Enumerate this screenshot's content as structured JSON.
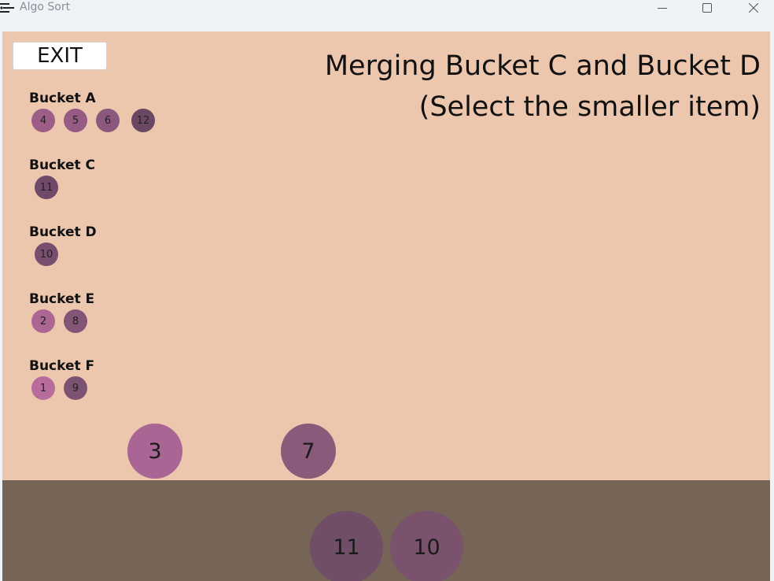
{
  "window": {
    "title": "Algo Sort",
    "controls": [
      "minimize-icon",
      "maximize-icon",
      "close-icon"
    ]
  },
  "exit_label": "EXIT",
  "heading": {
    "line1": "Merging Bucket C and Bucket D",
    "line2": "(Select the smaller item)"
  },
  "buckets": [
    {
      "name": "Bucket A",
      "items": [
        {
          "value": "4",
          "color": "#9d5d87"
        },
        {
          "value": "5",
          "color": "#965b82"
        },
        {
          "value": "6",
          "color": "#8c587c"
        },
        {
          "value": "12",
          "color": "#6a4763"
        }
      ]
    },
    {
      "name": "Bucket C",
      "items": [
        {
          "value": "11",
          "color": "#704a68"
        }
      ]
    },
    {
      "name": "Bucket D",
      "items": [
        {
          "value": "10",
          "color": "#784e6f"
        }
      ]
    },
    {
      "name": "Bucket E",
      "items": [
        {
          "value": "2",
          "color": "#ac6692"
        },
        {
          "value": "8",
          "color": "#825575"
        }
      ]
    },
    {
      "name": "Bucket F",
      "items": [
        {
          "value": "1",
          "color": "#b76c9b"
        },
        {
          "value": "9",
          "color": "#7b5272"
        }
      ]
    }
  ],
  "stage_items": [
    {
      "value": "3",
      "color": "#a96593"
    },
    {
      "value": "7",
      "color": "#8a5a7b"
    }
  ],
  "floor_items": [
    {
      "value": "11",
      "color": "#704e67"
    },
    {
      "value": "10",
      "color": "#7b526d"
    }
  ],
  "colors": {
    "stage_background": "#ecc7ae",
    "floor_background": "#766556",
    "titlebar_background": "#eef3f8"
  }
}
